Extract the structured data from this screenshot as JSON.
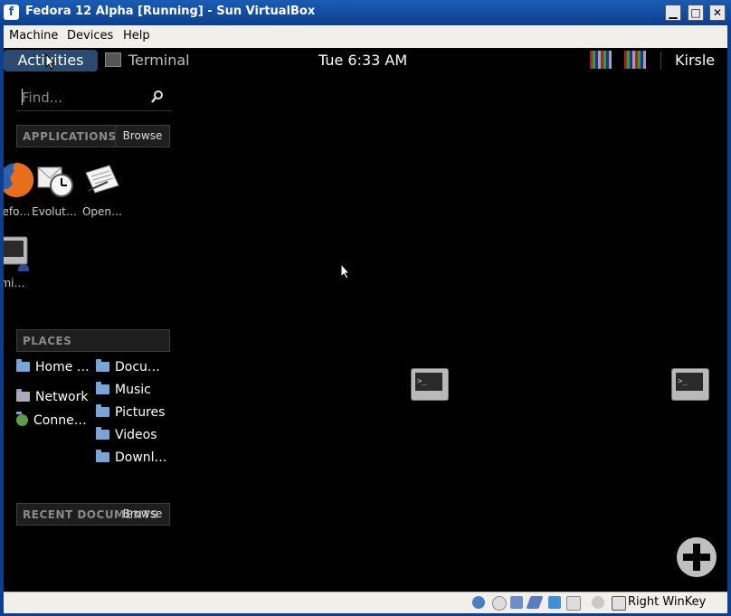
{
  "window": {
    "title": "Fedora 12 Alpha [Running] - Sun VirtualBox",
    "logo": "f",
    "controls": {
      "minimize": "▁",
      "maximize": "□",
      "close": "✕"
    }
  },
  "menubar": {
    "items": [
      "Machine",
      "Devices",
      "Help"
    ]
  },
  "topbar": {
    "activities_label": "Activities",
    "app_label": "Terminal",
    "clock": "Tue  6:33 AM",
    "user": "Kirsle"
  },
  "search": {
    "placeholder": "Find..."
  },
  "applications": {
    "header": "APPLICATIONS",
    "browse_label": "Browse",
    "apps": [
      "efo…",
      "Evolut…",
      "Open…",
      "mi…"
    ]
  },
  "places": {
    "header": "PLACES",
    "left": [
      "Home …",
      "Network",
      "Conne…"
    ],
    "folders": [
      "Docu…",
      "Music",
      "Pictures",
      "Videos",
      "Downl…"
    ]
  },
  "recent": {
    "header": "RECENT DOCUMENTS",
    "browse_label": "Browse"
  },
  "desktop": {
    "terminal_prompt": ">_"
  },
  "statusbar": {
    "host_key": "Right WinKey"
  }
}
